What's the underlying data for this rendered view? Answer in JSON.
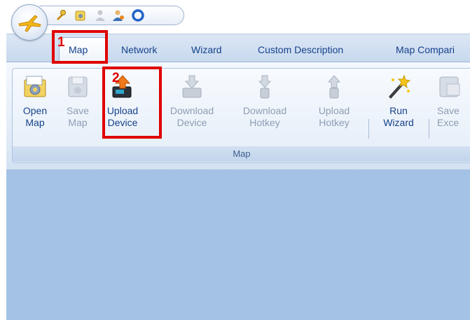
{
  "quick_access": {
    "icons": [
      "app-menu-icon",
      "tools-icon",
      "settings-icon",
      "user-icon",
      "user-admin-icon",
      "help-ring-icon"
    ]
  },
  "tabs": [
    {
      "label": "Map",
      "active": true
    },
    {
      "label": "Network"
    },
    {
      "label": "Wizard"
    },
    {
      "label": "Custom Description"
    },
    {
      "label": "Map Compari"
    }
  ],
  "ribbon": {
    "group_label": "Map",
    "buttons": [
      {
        "line1": "Open",
        "line2": "Map",
        "enabled": true,
        "icon": "open-map-icon"
      },
      {
        "line1": "Save",
        "line2": "Map",
        "enabled": false,
        "icon": "save-map-icon"
      },
      {
        "line1": "Upload",
        "line2": "Device",
        "enabled": true,
        "icon": "upload-device-icon"
      },
      {
        "line1": "Download",
        "line2": "Device",
        "enabled": false,
        "icon": "download-device-icon"
      },
      {
        "line1": "Download",
        "line2": "Hotkey",
        "enabled": false,
        "icon": "download-hotkey-icon"
      },
      {
        "line1": "Upload",
        "line2": "Hotkey",
        "enabled": false,
        "icon": "upload-hotkey-icon"
      },
      {
        "line1": "Run",
        "line2": "Wizard",
        "enabled": true,
        "icon": "run-wizard-icon"
      },
      {
        "line1": "Save",
        "line2": "Exce",
        "enabled": false,
        "icon": "save-excel-icon"
      }
    ]
  },
  "annotations": {
    "step1": "1",
    "step2": "2"
  },
  "colors": {
    "tab_text": "#15428b",
    "disabled_text": "#8d9db3",
    "callout": "#e00000",
    "workspace": "#a4c2e6"
  }
}
